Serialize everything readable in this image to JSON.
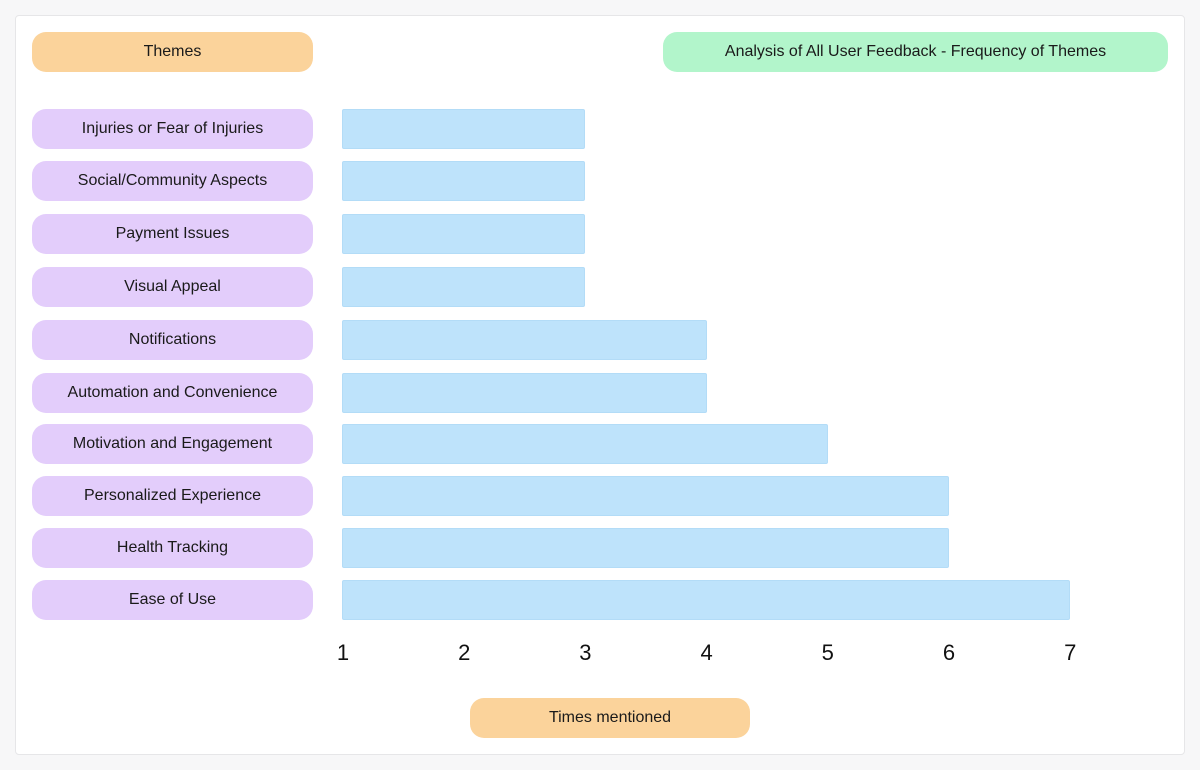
{
  "chart_data": {
    "type": "bar",
    "orientation": "horizontal",
    "title": "Analysis of All User Feedback - Frequency of Themes",
    "ylabel": "Themes",
    "xlabel": "Times mentioned",
    "categories": [
      "Injuries or Fear of Injuries",
      "Social/Community Aspects",
      "Payment Issues",
      "Visual Appeal",
      "Notifications",
      "Automation and Convenience",
      "Motivation and Engagement",
      "Personalized Experience",
      "Health Tracking",
      "Ease of Use"
    ],
    "values": [
      3,
      3,
      3,
      3,
      4,
      4,
      5,
      6,
      6,
      7
    ],
    "xticks": [
      "1",
      "2",
      "3",
      "4",
      "5",
      "6",
      "7"
    ],
    "xlim": [
      1,
      7
    ],
    "grid": false,
    "legend": "none"
  },
  "colors": {
    "header_pill": "#fbd39b",
    "title_pill": "#b2f5cb",
    "category_pill": "#e3cdfb",
    "bar": "#bee3fb"
  }
}
